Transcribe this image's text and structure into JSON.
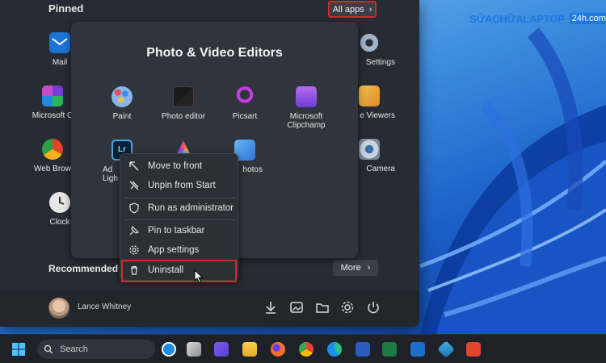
{
  "watermark": {
    "text": "SỬACHỮALAPTOP",
    "badge": "24h.com"
  },
  "start_menu": {
    "pinned_label": "Pinned",
    "all_apps_label": "All apps",
    "recommended_label": "Recommended",
    "more_label": "More",
    "pinned_apps": [
      {
        "label": "Mail",
        "icon": "mail-icon"
      },
      {
        "label": "Microsoft C",
        "icon": "microsoft-365-icon"
      },
      {
        "label": "Web Brow",
        "icon": "browser-icon"
      },
      {
        "label": "Clock",
        "icon": "clock-icon"
      },
      {
        "label": "Settings",
        "icon": "gear-icon"
      },
      {
        "label": "e Viewers",
        "icon": "photo-viewer-icon"
      },
      {
        "label": "Camera",
        "icon": "camera-icon"
      }
    ],
    "user": {
      "name": "Lance Whitney"
    }
  },
  "folder": {
    "title": "Photo & Video Editors",
    "apps": [
      {
        "label": "Paint",
        "icon": "paint-icon"
      },
      {
        "label": "Photo editor",
        "icon": "photo-editor-icon"
      },
      {
        "label": "Picsart",
        "icon": "picsart-icon"
      },
      {
        "label": "Microsoft",
        "label2": "Clipchamp",
        "icon": "clipchamp-icon"
      },
      {
        "label": "Ad",
        "label2": "Ligh",
        "icon": "lightroom-icon"
      },
      {
        "label": "",
        "icon": "photos-app-icon"
      },
      {
        "label": "hotos",
        "icon": "photos-icon"
      }
    ]
  },
  "context_menu": {
    "items": [
      {
        "label": "Move to front",
        "icon": "move-front-icon"
      },
      {
        "label": "Unpin from Start",
        "icon": "unpin-icon"
      },
      {
        "label": "Run as administrator",
        "icon": "shield-icon"
      },
      {
        "label": "Pin to taskbar",
        "icon": "pin-icon"
      },
      {
        "label": "App settings",
        "icon": "gear-icon"
      },
      {
        "label": "Uninstall",
        "icon": "trash-icon"
      }
    ]
  },
  "taskbar": {
    "search_label": "Search"
  },
  "colors": {
    "highlight": "#d22a2a",
    "menu_bg": "#272b33",
    "accent": "#1e79e0"
  }
}
